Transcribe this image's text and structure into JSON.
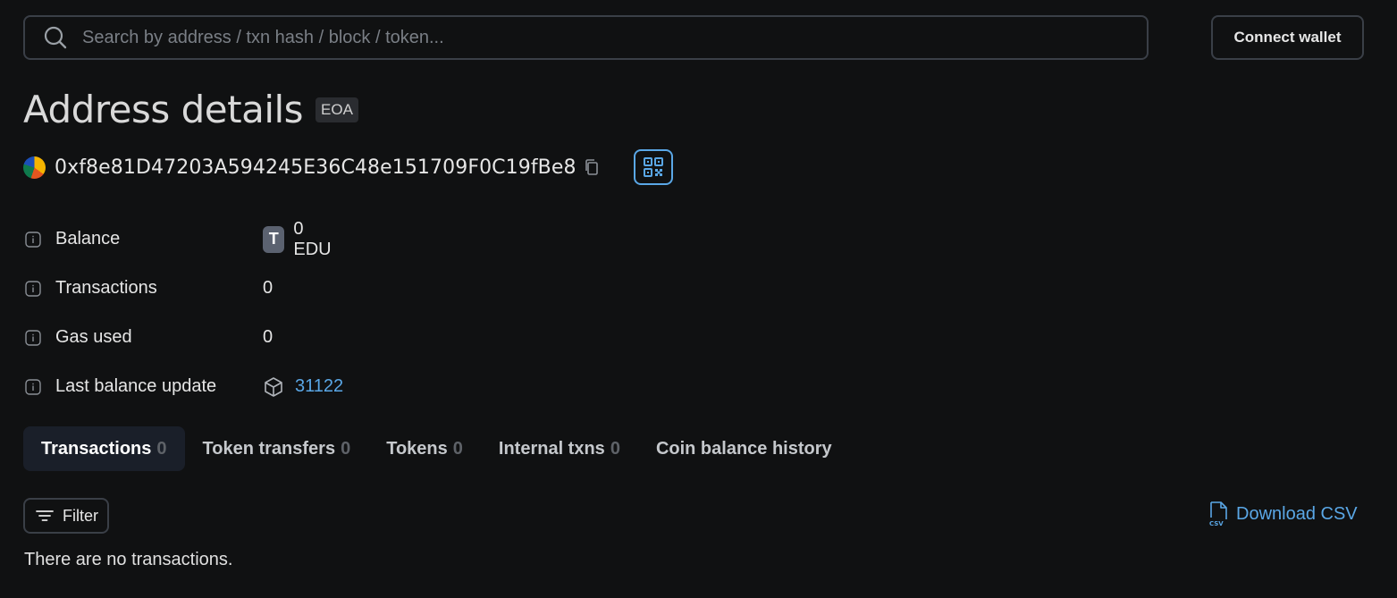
{
  "header": {
    "search_placeholder": "Search by address / txn hash / block / token...",
    "connect_label": "Connect wallet"
  },
  "page": {
    "title": "Address details",
    "badge": "EOA",
    "address": "0xf8e81D47203A594245E36C48e151709F0C19fBe8"
  },
  "details": {
    "balance_label": "Balance",
    "balance_token_letter": "T",
    "balance_value": "0 EDU",
    "transactions_label": "Transactions",
    "transactions_value": "0",
    "gas_label": "Gas used",
    "gas_value": "0",
    "last_update_label": "Last balance update",
    "last_update_block": "31122"
  },
  "tabs": [
    {
      "label": "Transactions",
      "count": "0",
      "active": true
    },
    {
      "label": "Token transfers",
      "count": "0"
    },
    {
      "label": "Tokens",
      "count": "0"
    },
    {
      "label": "Internal txns",
      "count": "0"
    },
    {
      "label": "Coin balance history"
    }
  ],
  "toolbar": {
    "filter_label": "Filter",
    "download_label": "Download CSV"
  },
  "empty_message": "There are no transactions.",
  "colors": {
    "background": "#101112",
    "accent": "#5aa7e6",
    "border": "#3a3f47"
  },
  "icons": [
    "search-icon",
    "avatar",
    "copy-icon",
    "qr-code-icon",
    "info-icon",
    "token-icon",
    "block-icon",
    "filter-icon",
    "csv-file-icon"
  ]
}
